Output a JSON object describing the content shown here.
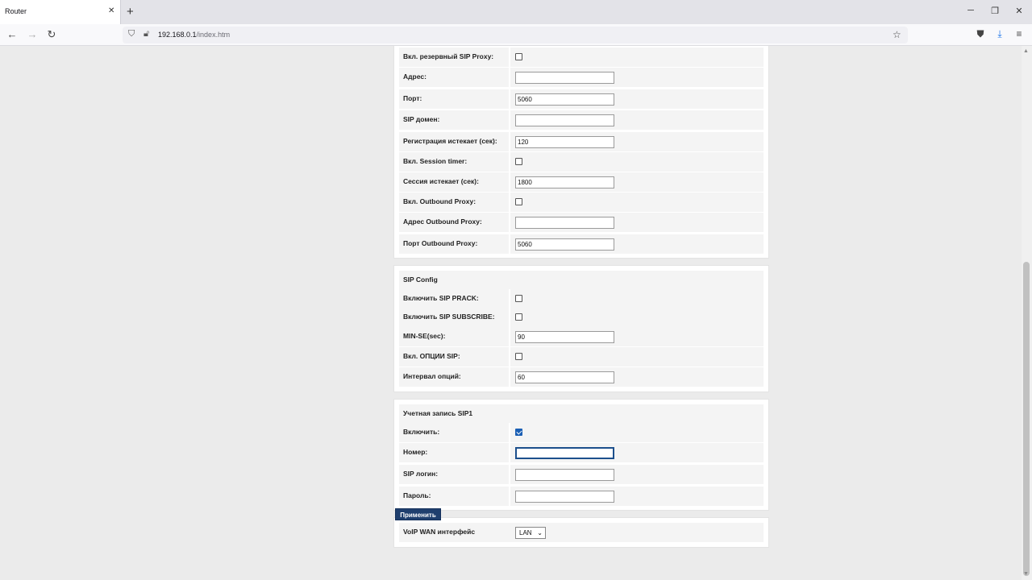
{
  "browser": {
    "tab_title": "Router",
    "tab_close": "✕",
    "new_tab": "+",
    "url_host": "192.168.0.1",
    "url_path": "/index.htm"
  },
  "section_proxy": {
    "rows": [
      {
        "label": "Вкл. резервный SIP Proxy:",
        "type": "checkbox",
        "checked": false
      },
      {
        "label": "Адрес:",
        "type": "text",
        "value": ""
      },
      {
        "label": "Порт:",
        "type": "text",
        "value": "5060"
      },
      {
        "label": "SIP домен:",
        "type": "text",
        "value": ""
      },
      {
        "label": "Регистрация истекает (сек):",
        "type": "text",
        "value": "120"
      },
      {
        "label": "Вкл. Session timer:",
        "type": "checkbox",
        "checked": false
      },
      {
        "label": "Сессия истекает (сек):",
        "type": "text",
        "value": "1800"
      },
      {
        "label": "Вкл. Outbound Proxy:",
        "type": "checkbox",
        "checked": false
      },
      {
        "label": "Адрес Outbound Proxy:",
        "type": "text",
        "value": ""
      },
      {
        "label": "Порт Outbound Proxy:",
        "type": "text",
        "value": "5060"
      }
    ]
  },
  "section_sip_config": {
    "title": "SIP Config",
    "rows": [
      {
        "label": "Включить SIP PRACK:",
        "type": "checkbox",
        "checked": false
      },
      {
        "label": "Включить SIP SUBSCRIBE:",
        "type": "checkbox",
        "checked": false
      },
      {
        "label": "MIN-SE(sec):",
        "type": "text",
        "value": "90"
      },
      {
        "label": "Вкл. ОПЦИИ SIP:",
        "type": "checkbox",
        "checked": false
      },
      {
        "label": "Интервал опций:",
        "type": "text",
        "value": "60"
      }
    ]
  },
  "section_account": {
    "title": "Учетная запись SIP1",
    "rows": [
      {
        "label": "Включить:",
        "type": "checkbox",
        "checked": true
      },
      {
        "label": "Номер:",
        "type": "text",
        "value": ""
      },
      {
        "label": "SIP логин:",
        "type": "text",
        "value": ""
      },
      {
        "label": "Пароль:",
        "type": "text",
        "value": ""
      }
    ]
  },
  "section_wan": {
    "label": "VoIP WAN интерфейс",
    "selected": "LAN"
  },
  "apply_label": "Применить"
}
